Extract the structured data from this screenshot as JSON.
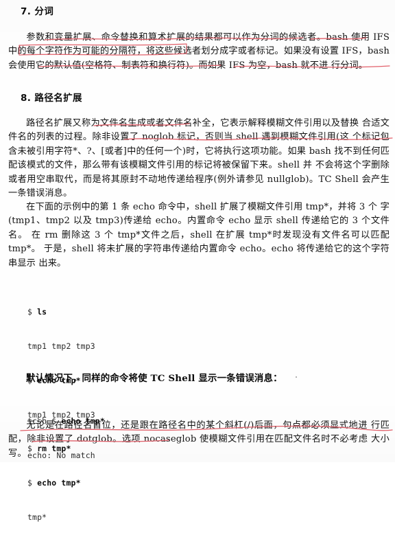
{
  "document": {
    "type": "scanned-book-page",
    "language": "zh-CN",
    "annotation_color": "#e2606a",
    "text_color": "#131313",
    "background_color": "#fefefe"
  },
  "sections": [
    {
      "heading": "7. 分词",
      "paragraph_lines": [
        "参数和变量扩展、命令替换和算术扩展的结果都可以作为分词的候选者。bash 使用",
        "IFS 中的每个字符作为可能的分隔符，将这些候选者划分成字或者标记。如果没有设置",
        "IFS，bash 会使用它的默认值(空格符、制表符和换行符)。而如果 IFS 为空，bash 就不进",
        "行分词。"
      ]
    },
    {
      "heading": "8. 路径名扩展",
      "paragraph_lines": [
        "路径名扩展又称为文件名生成或者文件名补全，它表示解释模糊文件引用以及替换",
        "合适文件名的列表的过程。除非设置了 noglob 标记，否则当 shell 遇到模糊文件引用(这",
        "个标记包含未被引用字符*、?、[或者]中的任何一个)时，它将执行这项功能。如果 bash",
        "找不到任何匹配该模式的文件，那么带有该模糊文件引用的标记将被保留下来。shell 并",
        "不会将这个字删除或者用空串取代，而是将其原封不动地传递给程序(例外请参见",
        "nullglob)。TC Shell 会产生一条错误消息。"
      ],
      "paragraph2_lines": [
        "在下面的示例中的第 1 条 echo 命令中，shell 扩展了模糊文件引用 tmp*，并将 3 个",
        "字(tmp1、tmp2 以及 tmp3)传递给 echo。内置命令 echo 显示 shell 传递给它的 3 个文件名。",
        "在 rm 删除这 3 个 tmp*文件之后，shell 在扩展 tmp*时发现没有文件名可以匹配 tmp*。",
        "于是，shell 将未扩展的字符串传递给内置命令 echo。echo 将传递给它的这个字符串显示",
        "出来。"
      ]
    }
  ],
  "code_block_1": {
    "lines": [
      {
        "prompt": "$ ",
        "command": "ls",
        "bold": true
      },
      {
        "prompt": "",
        "command": "tmp1 tmp2 tmp3",
        "bold": false
      },
      {
        "prompt": "$ ",
        "command": "echo tmp*",
        "bold": true
      },
      {
        "prompt": "",
        "command": "tmp1 tmp2 tmp3",
        "bold": false
      },
      {
        "prompt": "$ ",
        "command": "rm tmp*",
        "bold": true
      },
      {
        "prompt": "$ ",
        "command": "echo tmp*",
        "bold": true
      },
      {
        "prompt": "",
        "command": "tmp*",
        "bold": false
      }
    ]
  },
  "tcshell_note": "默认情况下，同样的命令将使 TC Shell 显示一条错误消息：",
  "code_block_2": {
    "lines": [
      {
        "prompt": "tcsh $ ",
        "command": "echo tmp*",
        "bold": true
      },
      {
        "prompt": "",
        "command": "echo: No match",
        "bold": false
      }
    ]
  },
  "final_paragraph_lines": [
    "无论是在路径名首位，还是跟在路径名中的某个斜杠(/)后面，句点都必须显式地进",
    "行匹配，除非设置了 dotglob。选项 nocaseglob 使模糊文件引用在匹配文件名时不必考虑",
    "大小写。"
  ],
  "annotations": [
    {
      "id": "mark-1",
      "target": "命令替换和算术扩展的结果都可以作为分词的候选者。",
      "style": "underline"
    },
    {
      "id": "mark-2",
      "target": "bash 使用",
      "style": "underline"
    },
    {
      "id": "mark-3",
      "target": "中的每个字符作为可能的分隔符，",
      "style": "box"
    },
    {
      "id": "mark-4",
      "target": "会使用它的默认值(空格符、制表符和换行符)。",
      "style": "underline"
    },
    {
      "id": "mark-5",
      "target": "而如果 IFS 为空，bash 就不进",
      "style": "underline"
    },
    {
      "id": "mark-6",
      "target": "文件名生成或者文件名补全，",
      "style": "underline"
    },
    {
      "id": "mark-7",
      "target": "除非设置了 noglob 标记，否则当 shell 遇到模糊文件引用(这",
      "style": "underline"
    },
    {
      "id": "mark-8",
      "target": "无论是在路径名首位，还是跟在路径名中的某个斜杠(/)后面，句点都必须显式地进",
      "style": "underline"
    },
    {
      "id": "mark-9",
      "target": "除非设置了 dotglob。选项",
      "style": "underline"
    }
  ]
}
